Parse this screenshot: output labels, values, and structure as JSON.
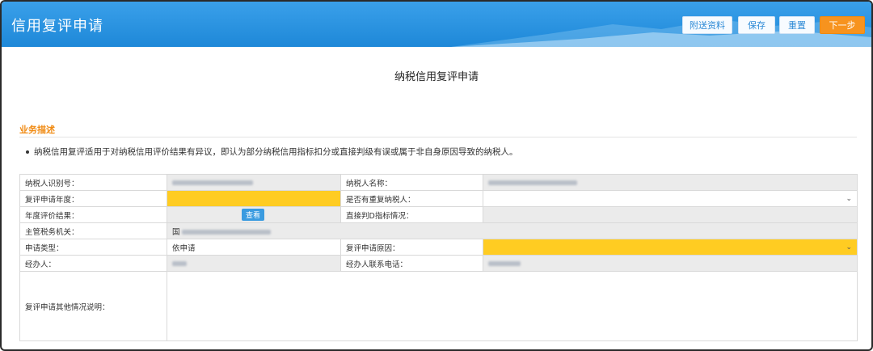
{
  "header": {
    "title": "信用复评申请",
    "buttons": {
      "attach": "附送资料",
      "save": "保存",
      "reset": "重置",
      "next": "下一步"
    }
  },
  "page_title": "纳税信用复评申请",
  "section": {
    "label": "业务描述",
    "description": "纳税信用复评适用于对纳税信用评价结果有异议，即认为部分纳税信用指标扣分或直接判级有误或属于非自身原因导致的纳税人。"
  },
  "form": {
    "taxpayer_id_label": "纳税人识别号：",
    "taxpayer_name_label": "纳税人名称：",
    "review_year_label": "复评申请年度：",
    "duplicate_taxpayer_label": "是否有重复纳税人：",
    "annual_result_label": "年度评价结果：",
    "view_button": "查看",
    "direct_d_label": "直接判D指标情况：",
    "tax_authority_label": "主管税务机关：",
    "tax_authority_prefix": "国",
    "apply_type_label": "申请类型：",
    "apply_type_value": "依申请",
    "review_reason_label": "复评申请原因：",
    "handler_label": "经办人：",
    "handler_phone_label": "经办人联系电话：",
    "other_notes_label": "复评申请其他情况说明："
  },
  "colors": {
    "header_blue": "#1e88d8",
    "accent_orange": "#f7931e",
    "required_yellow": "#ffcc22"
  }
}
